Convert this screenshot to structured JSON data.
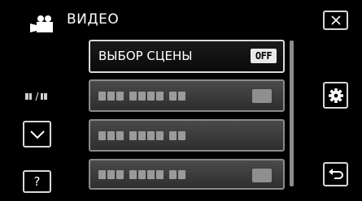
{
  "header": {
    "title": "ВИДЕО",
    "mode_icon": "video-camera-icon"
  },
  "controls": {
    "close_icon": "close-icon",
    "settings_icon": "gear-icon",
    "down_icon": "chevron-down-icon",
    "help_label": "?",
    "back_icon": "return-arrow-icon",
    "page_indicator_icon": "page-indicator-icon"
  },
  "menu": {
    "items": [
      {
        "label": "ВЫБОР СЦЕНЫ",
        "value": "OFF",
        "state": "active"
      },
      {
        "label": "",
        "state": "dimmed"
      },
      {
        "label": "",
        "state": "dimmed"
      },
      {
        "label": "",
        "state": "dimmed"
      }
    ]
  },
  "colors": {
    "background": "#000000",
    "border_active": "#d9d9d9",
    "item_dimmed": "#3a3a3a",
    "badge_bg": "#e8e8e8"
  }
}
